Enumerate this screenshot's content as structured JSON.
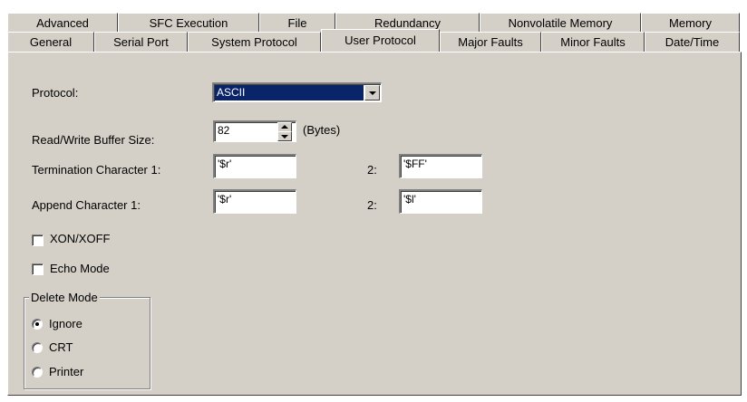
{
  "tabs": {
    "back_row": [
      "Advanced",
      "SFC Execution",
      "File",
      "Redundancy",
      "Nonvolatile Memory",
      "Memory"
    ],
    "front_row": [
      "General",
      "Serial Port",
      "System Protocol",
      "User Protocol",
      "Major Faults",
      "Minor Faults",
      "Date/Time"
    ],
    "selected": "User Protocol"
  },
  "form": {
    "protocol": {
      "label": "Protocol:",
      "value": "ASCII"
    },
    "buffer": {
      "label": "Read/Write Buffer Size:",
      "value": "82",
      "unit": "(Bytes)"
    },
    "termination": {
      "label": "Termination Character 1:",
      "value1": "'$r'",
      "label2": "2:",
      "value2": "'$FF'"
    },
    "append": {
      "label": "Append Character 1:",
      "value1": "'$r'",
      "label2": "2:",
      "value2": "'$l'"
    },
    "xon_xoff": {
      "label": "XON/XOFF",
      "checked": false
    },
    "echo_mode": {
      "label": "Echo Mode",
      "checked": false
    },
    "delete_mode": {
      "title": "Delete Mode",
      "options": [
        "Ignore",
        "CRT",
        "Printer"
      ],
      "selected": "Ignore"
    }
  }
}
